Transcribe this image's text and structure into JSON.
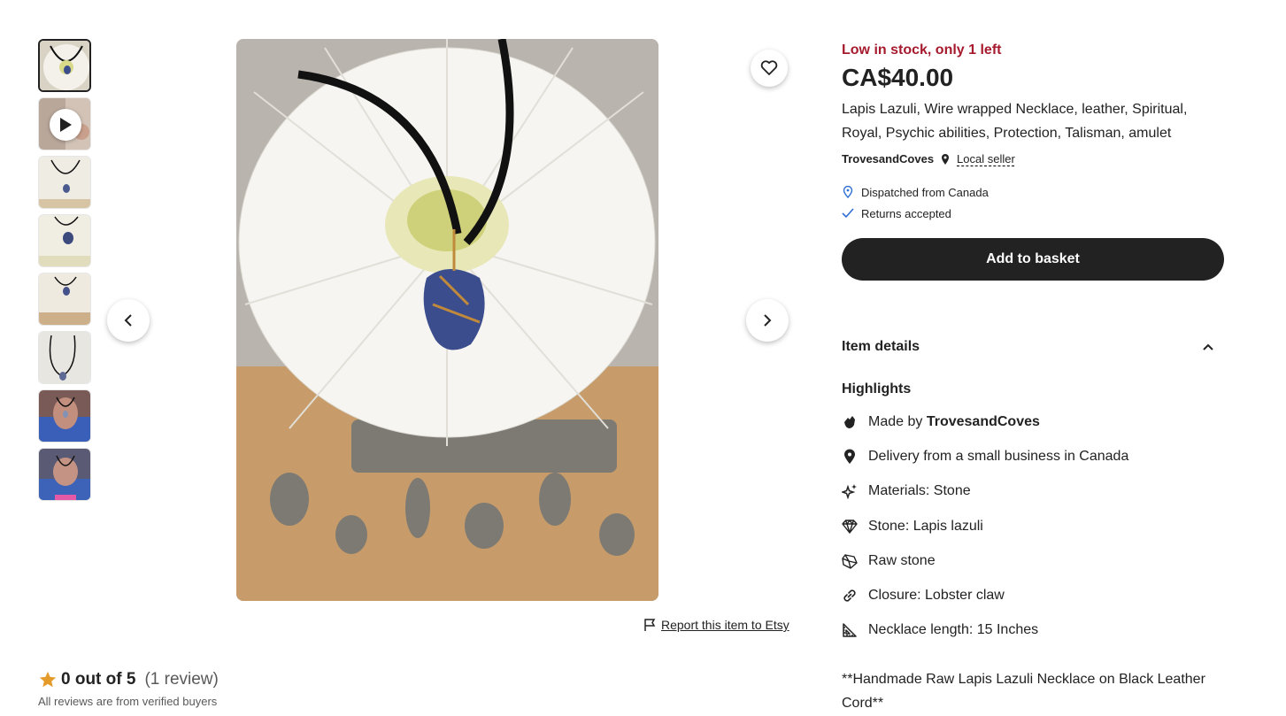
{
  "thumbnails": [
    {
      "kind": "image",
      "active": true
    },
    {
      "kind": "video"
    },
    {
      "kind": "image"
    },
    {
      "kind": "image"
    },
    {
      "kind": "image"
    },
    {
      "kind": "image"
    },
    {
      "kind": "image"
    },
    {
      "kind": "image"
    }
  ],
  "main_image": {
    "alt_icon": "product-photo"
  },
  "report": {
    "label": "Report this item to Etsy",
    "icon": "flag-icon"
  },
  "reviews": {
    "score": "0 out of 5",
    "count": "(1 review)",
    "verified": "All reviews are from verified buyers"
  },
  "product": {
    "stock": "Low in stock, only 1 left",
    "price": "CA$40.00",
    "title": "Lapis Lazuli, Wire wrapped Necklace, leather, Spiritual, Royal, Psychic abilities, Protection, Talisman, amulet",
    "seller": "TrovesandCoves",
    "local_seller": "Local seller",
    "dispatched": "Dispatched from Canada",
    "returns": "Returns accepted",
    "add_to_basket": "Add to basket"
  },
  "details": {
    "header": "Item details",
    "highlights_title": "Highlights",
    "highlights": {
      "made_by_prefix": "Made by",
      "made_by_name": "TrovesandCoves",
      "delivery": "Delivery from a small business in Canada",
      "materials": "Materials: Stone",
      "stone": "Stone: Lapis lazuli",
      "raw": "Raw stone",
      "closure": "Closure: Lobster claw",
      "length": "Necklace length: 15 Inches"
    },
    "description": "**Handmade Raw Lapis Lazuli Necklace on Black Leather Cord**"
  },
  "colors": {
    "accent_red": "#a61a2e",
    "button_dark": "#222222",
    "star": "#e59b2b",
    "check_blue": "#2f6fd6"
  }
}
